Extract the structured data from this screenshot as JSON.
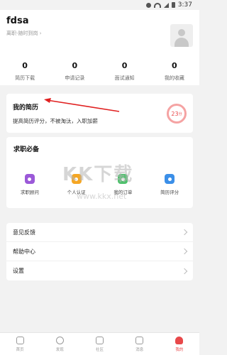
{
  "status_bar": {
    "time": "3:37"
  },
  "profile": {
    "username": "fdsa",
    "status": "离职-随时到岗 ›"
  },
  "stats": [
    {
      "count": "0",
      "label": "简历下载"
    },
    {
      "count": "0",
      "label": "申请记录"
    },
    {
      "count": "0",
      "label": "面试通知"
    },
    {
      "count": "0",
      "label": "我的收藏"
    }
  ],
  "resume": {
    "title": "我的简历",
    "subtitle": "提高简历评分，不被淘汰，入职加薪",
    "score": "23",
    "score_unit": "分"
  },
  "essentials": {
    "title": "求职必备",
    "items": [
      {
        "label": "求职顾问",
        "color": "#9b59d8"
      },
      {
        "label": "个人认证",
        "color": "#f5a623"
      },
      {
        "label": "我的订单",
        "color": "#4cc16b"
      },
      {
        "label": "简历评分",
        "color": "#3b8fe8"
      }
    ]
  },
  "watermark": {
    "main": "KK下载",
    "sub": "www.kkx.net"
  },
  "menu": [
    {
      "label": "意见反馈"
    },
    {
      "label": "帮助中心"
    },
    {
      "label": "设置"
    }
  ],
  "tabbar": [
    {
      "label": "首页",
      "icon": "home-icon"
    },
    {
      "label": "发现",
      "icon": "compass-icon"
    },
    {
      "label": "社区",
      "icon": "community-icon"
    },
    {
      "label": "消息",
      "icon": "message-icon"
    },
    {
      "label": "我的",
      "icon": "profile-icon"
    }
  ],
  "colors": {
    "accent": "#e8484a"
  }
}
